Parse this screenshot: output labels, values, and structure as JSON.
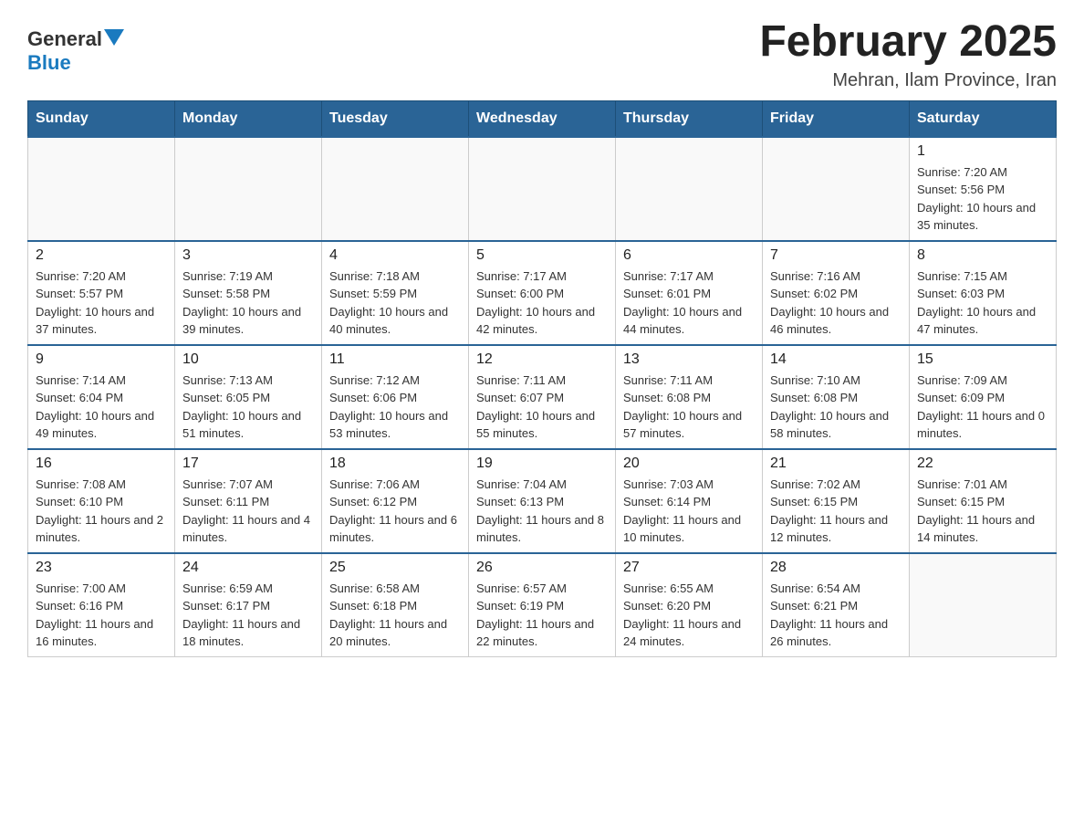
{
  "logo": {
    "general": "General",
    "arrow": "▲",
    "blue": "Blue"
  },
  "title": "February 2025",
  "subtitle": "Mehran, Ilam Province, Iran",
  "days_of_week": [
    "Sunday",
    "Monday",
    "Tuesday",
    "Wednesday",
    "Thursday",
    "Friday",
    "Saturday"
  ],
  "weeks": [
    [
      {
        "day": "",
        "sunrise": "",
        "sunset": "",
        "daylight": ""
      },
      {
        "day": "",
        "sunrise": "",
        "sunset": "",
        "daylight": ""
      },
      {
        "day": "",
        "sunrise": "",
        "sunset": "",
        "daylight": ""
      },
      {
        "day": "",
        "sunrise": "",
        "sunset": "",
        "daylight": ""
      },
      {
        "day": "",
        "sunrise": "",
        "sunset": "",
        "daylight": ""
      },
      {
        "day": "",
        "sunrise": "",
        "sunset": "",
        "daylight": ""
      },
      {
        "day": "1",
        "sunrise": "Sunrise: 7:20 AM",
        "sunset": "Sunset: 5:56 PM",
        "daylight": "Daylight: 10 hours and 35 minutes."
      }
    ],
    [
      {
        "day": "2",
        "sunrise": "Sunrise: 7:20 AM",
        "sunset": "Sunset: 5:57 PM",
        "daylight": "Daylight: 10 hours and 37 minutes."
      },
      {
        "day": "3",
        "sunrise": "Sunrise: 7:19 AM",
        "sunset": "Sunset: 5:58 PM",
        "daylight": "Daylight: 10 hours and 39 minutes."
      },
      {
        "day": "4",
        "sunrise": "Sunrise: 7:18 AM",
        "sunset": "Sunset: 5:59 PM",
        "daylight": "Daylight: 10 hours and 40 minutes."
      },
      {
        "day": "5",
        "sunrise": "Sunrise: 7:17 AM",
        "sunset": "Sunset: 6:00 PM",
        "daylight": "Daylight: 10 hours and 42 minutes."
      },
      {
        "day": "6",
        "sunrise": "Sunrise: 7:17 AM",
        "sunset": "Sunset: 6:01 PM",
        "daylight": "Daylight: 10 hours and 44 minutes."
      },
      {
        "day": "7",
        "sunrise": "Sunrise: 7:16 AM",
        "sunset": "Sunset: 6:02 PM",
        "daylight": "Daylight: 10 hours and 46 minutes."
      },
      {
        "day": "8",
        "sunrise": "Sunrise: 7:15 AM",
        "sunset": "Sunset: 6:03 PM",
        "daylight": "Daylight: 10 hours and 47 minutes."
      }
    ],
    [
      {
        "day": "9",
        "sunrise": "Sunrise: 7:14 AM",
        "sunset": "Sunset: 6:04 PM",
        "daylight": "Daylight: 10 hours and 49 minutes."
      },
      {
        "day": "10",
        "sunrise": "Sunrise: 7:13 AM",
        "sunset": "Sunset: 6:05 PM",
        "daylight": "Daylight: 10 hours and 51 minutes."
      },
      {
        "day": "11",
        "sunrise": "Sunrise: 7:12 AM",
        "sunset": "Sunset: 6:06 PM",
        "daylight": "Daylight: 10 hours and 53 minutes."
      },
      {
        "day": "12",
        "sunrise": "Sunrise: 7:11 AM",
        "sunset": "Sunset: 6:07 PM",
        "daylight": "Daylight: 10 hours and 55 minutes."
      },
      {
        "day": "13",
        "sunrise": "Sunrise: 7:11 AM",
        "sunset": "Sunset: 6:08 PM",
        "daylight": "Daylight: 10 hours and 57 minutes."
      },
      {
        "day": "14",
        "sunrise": "Sunrise: 7:10 AM",
        "sunset": "Sunset: 6:08 PM",
        "daylight": "Daylight: 10 hours and 58 minutes."
      },
      {
        "day": "15",
        "sunrise": "Sunrise: 7:09 AM",
        "sunset": "Sunset: 6:09 PM",
        "daylight": "Daylight: 11 hours and 0 minutes."
      }
    ],
    [
      {
        "day": "16",
        "sunrise": "Sunrise: 7:08 AM",
        "sunset": "Sunset: 6:10 PM",
        "daylight": "Daylight: 11 hours and 2 minutes."
      },
      {
        "day": "17",
        "sunrise": "Sunrise: 7:07 AM",
        "sunset": "Sunset: 6:11 PM",
        "daylight": "Daylight: 11 hours and 4 minutes."
      },
      {
        "day": "18",
        "sunrise": "Sunrise: 7:06 AM",
        "sunset": "Sunset: 6:12 PM",
        "daylight": "Daylight: 11 hours and 6 minutes."
      },
      {
        "day": "19",
        "sunrise": "Sunrise: 7:04 AM",
        "sunset": "Sunset: 6:13 PM",
        "daylight": "Daylight: 11 hours and 8 minutes."
      },
      {
        "day": "20",
        "sunrise": "Sunrise: 7:03 AM",
        "sunset": "Sunset: 6:14 PM",
        "daylight": "Daylight: 11 hours and 10 minutes."
      },
      {
        "day": "21",
        "sunrise": "Sunrise: 7:02 AM",
        "sunset": "Sunset: 6:15 PM",
        "daylight": "Daylight: 11 hours and 12 minutes."
      },
      {
        "day": "22",
        "sunrise": "Sunrise: 7:01 AM",
        "sunset": "Sunset: 6:15 PM",
        "daylight": "Daylight: 11 hours and 14 minutes."
      }
    ],
    [
      {
        "day": "23",
        "sunrise": "Sunrise: 7:00 AM",
        "sunset": "Sunset: 6:16 PM",
        "daylight": "Daylight: 11 hours and 16 minutes."
      },
      {
        "day": "24",
        "sunrise": "Sunrise: 6:59 AM",
        "sunset": "Sunset: 6:17 PM",
        "daylight": "Daylight: 11 hours and 18 minutes."
      },
      {
        "day": "25",
        "sunrise": "Sunrise: 6:58 AM",
        "sunset": "Sunset: 6:18 PM",
        "daylight": "Daylight: 11 hours and 20 minutes."
      },
      {
        "day": "26",
        "sunrise": "Sunrise: 6:57 AM",
        "sunset": "Sunset: 6:19 PM",
        "daylight": "Daylight: 11 hours and 22 minutes."
      },
      {
        "day": "27",
        "sunrise": "Sunrise: 6:55 AM",
        "sunset": "Sunset: 6:20 PM",
        "daylight": "Daylight: 11 hours and 24 minutes."
      },
      {
        "day": "28",
        "sunrise": "Sunrise: 6:54 AM",
        "sunset": "Sunset: 6:21 PM",
        "daylight": "Daylight: 11 hours and 26 minutes."
      },
      {
        "day": "",
        "sunrise": "",
        "sunset": "",
        "daylight": ""
      }
    ]
  ]
}
